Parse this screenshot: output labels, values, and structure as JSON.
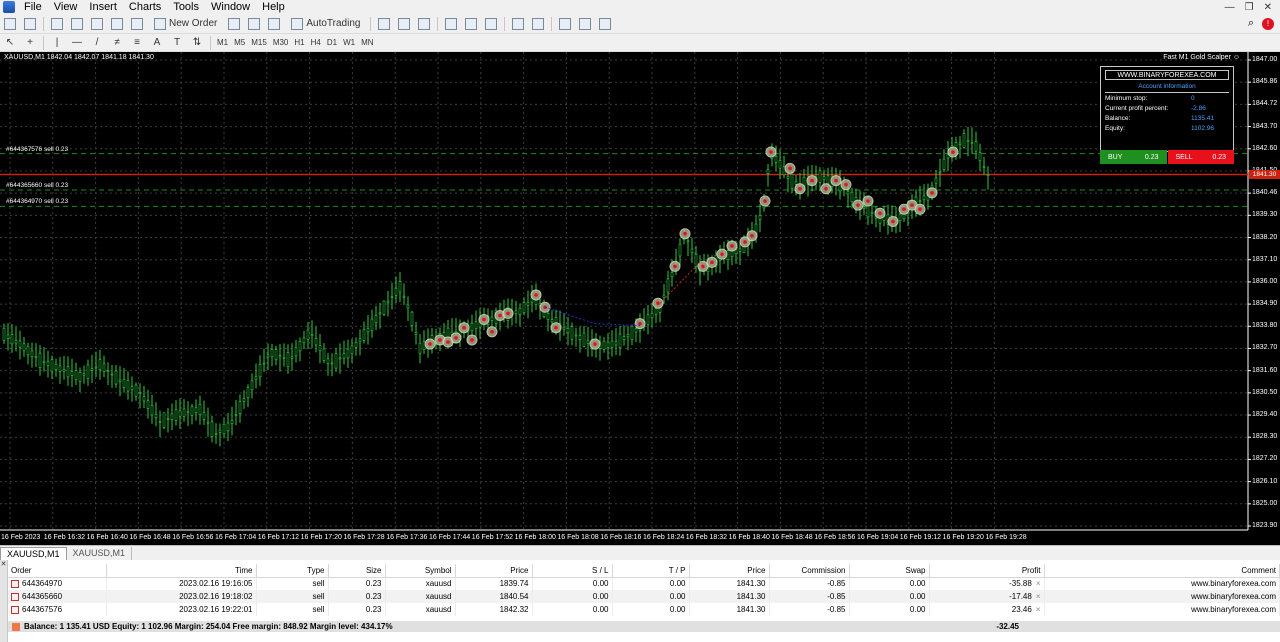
{
  "menu": [
    "File",
    "View",
    "Insert",
    "Charts",
    "Tools",
    "Window",
    "Help"
  ],
  "toolbar": {
    "new_order": "New Order",
    "autotrading": "AutoTrading",
    "timeframes": [
      "M1",
      "M5",
      "M15",
      "M30",
      "H1",
      "H4",
      "D1",
      "W1",
      "MN"
    ]
  },
  "chart": {
    "title": "XAUUSD,M1  1842.04 1842.07 1841.18 1841.30",
    "ea_name": "Fast M1 Gold Scalper ☺",
    "bid_price_tag": "1841.30",
    "y_labels": [
      "1847.00",
      "1845.86",
      "1844.72",
      "1843.70",
      "1842.60",
      "1841.50",
      "1840.46",
      "1839.30",
      "1838.20",
      "1837.10",
      "1836.00",
      "1834.90",
      "1833.80",
      "1832.70",
      "1831.60",
      "1830.50",
      "1829.40",
      "1828.30",
      "1827.20",
      "1826.10",
      "1825.00",
      "1823.90"
    ],
    "x_labels": [
      "16 Feb 2023",
      "16 Feb 16:32",
      "16 Feb 16:40",
      "16 Feb 16:48",
      "16 Feb 16:56",
      "16 Feb 17:04",
      "16 Feb 17:12",
      "16 Feb 17:20",
      "16 Feb 17:28",
      "16 Feb 17:36",
      "16 Feb 17:44",
      "16 Feb 17:52",
      "16 Feb 18:00",
      "16 Feb 18:08",
      "16 Feb 18:16",
      "16 Feb 18:24",
      "16 Feb 18:32",
      "16 Feb 18:40",
      "16 Feb 18:48",
      "16 Feb 18:56",
      "16 Feb 19:04",
      "16 Feb 19:12",
      "16 Feb 19:20",
      "16 Feb 19:28"
    ],
    "order_lines": [
      {
        "label": "#644367576 sell 0.23",
        "price": 1842.32
      },
      {
        "label": "#644365660 sell 0.23",
        "price": 1840.54
      },
      {
        "label": "#644364970 sell 0.23",
        "price": 1839.74
      }
    ],
    "colors": {
      "bull": "#2ecc40",
      "bear": "#2ecc40",
      "grid": "#3c3c3c",
      "order_line": "#1a8f1a",
      "bid_line": "#c21",
      "background": "#000000"
    }
  },
  "account_panel": {
    "site": "WWW.BINARYFOREXEA.COM",
    "header": "Account information",
    "rows": [
      {
        "k": "Minimum stop:",
        "v": "0"
      },
      {
        "k": "Current profit percent:",
        "v": "-2.86"
      },
      {
        "k": "Balance:",
        "v": "1135.41"
      },
      {
        "k": "Equity:",
        "v": "1102.96"
      }
    ],
    "buy_label": "BUY",
    "buy_lot": "0.23",
    "sell_label": "SELL",
    "sell_lot": "0.23"
  },
  "chart_tabs": [
    "XAUUSD,M1",
    "XAUUSD,M1"
  ],
  "terminal": {
    "columns": [
      "Order",
      "Time",
      "Type",
      "Size",
      "Symbol",
      "Price",
      "S / L",
      "T / P",
      "Price",
      "Commission",
      "Swap",
      "Profit",
      "Comment"
    ],
    "rows": [
      [
        "644364970",
        "2023.02.16 19:16:05",
        "sell",
        "0.23",
        "xauusd",
        "1839.74",
        "0.00",
        "0.00",
        "1841.30",
        "-0.85",
        "0.00",
        "-35.88",
        "www.binaryforexea.com"
      ],
      [
        "644365660",
        "2023.02.16 19:18:02",
        "sell",
        "0.23",
        "xauusd",
        "1840.54",
        "0.00",
        "0.00",
        "1841.30",
        "-0.85",
        "0.00",
        "-17.48",
        "www.binaryforexea.com"
      ],
      [
        "644367576",
        "2023.02.16 19:22:01",
        "sell",
        "0.23",
        "xauusd",
        "1842.32",
        "0.00",
        "0.00",
        "1841.30",
        "-0.85",
        "0.00",
        "23.46",
        "www.binaryforexea.com"
      ]
    ],
    "summary": "Balance: 1 135.41 USD  Equity: 1 102.96  Margin: 254.04  Free margin: 848.92  Margin level: 434.17%",
    "profit_total": "-32.45"
  }
}
